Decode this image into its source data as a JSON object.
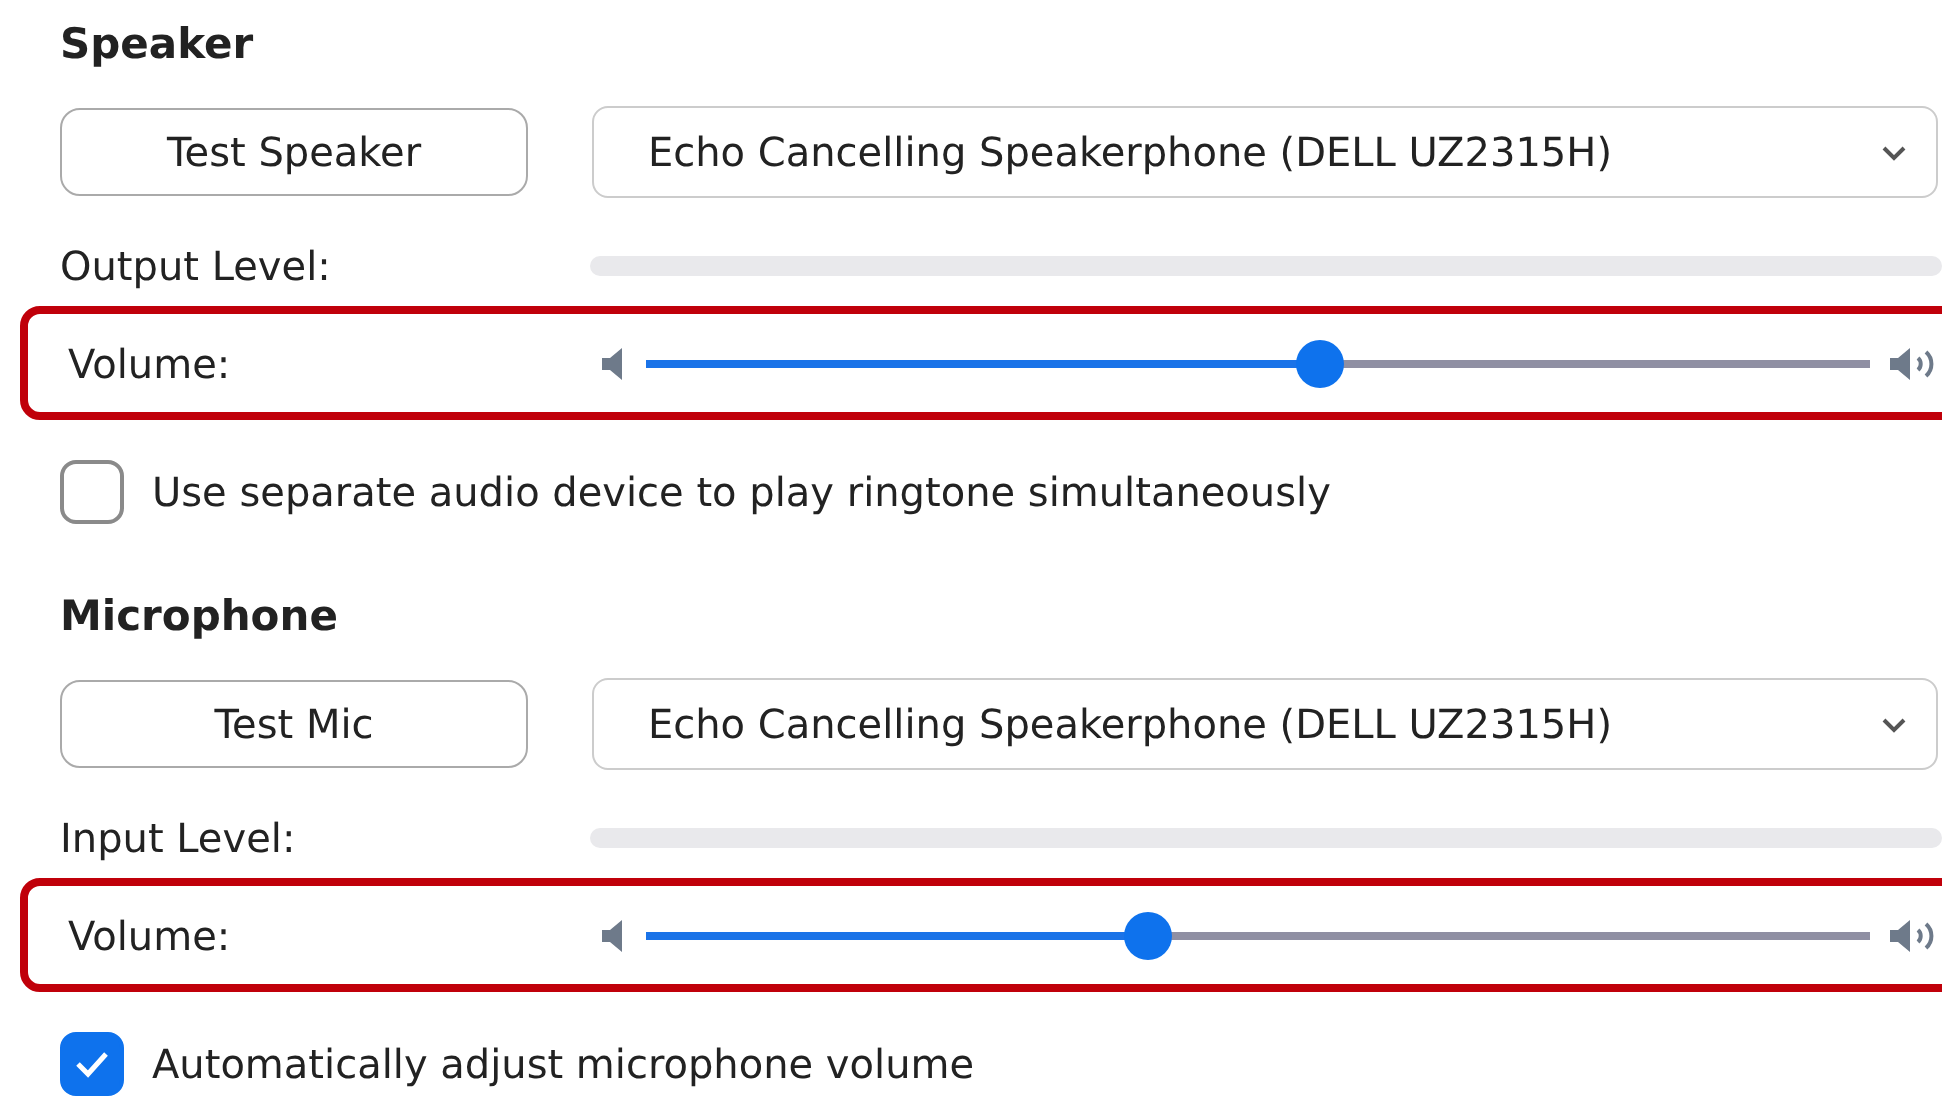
{
  "sections": [
    {
      "title": "Speaker",
      "test_button": "Test Speaker",
      "device": "Echo Cancelling Speakerphone (DELL UZ2315H)",
      "level_label": "Output Level:",
      "level": 0,
      "volume": {
        "label": "Volume:",
        "level": 0.55,
        "highlighted": true
      },
      "checkbox": {
        "label": "Use separate audio device to play ringtone simultaneously",
        "checked": false
      }
    },
    {
      "title": "Microphone",
      "test_button": "Test Mic",
      "device": "Echo Cancelling Speakerphone (DELL UZ2315H)",
      "level_label": "Input Level:",
      "level": 0,
      "volume": {
        "label": "Volume:",
        "level": 0.41,
        "highlighted": true
      },
      "checkbox": {
        "label": "Automatically adjust microphone volume",
        "checked": true
      }
    }
  ]
}
